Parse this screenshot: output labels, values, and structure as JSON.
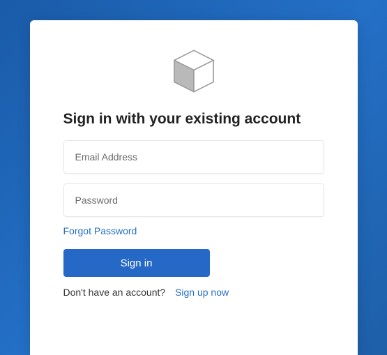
{
  "title": "Sign in with your existing account",
  "fields": {
    "email_placeholder": "Email Address",
    "password_placeholder": "Password"
  },
  "links": {
    "forgot": "Forgot Password",
    "signup": "Sign up now"
  },
  "buttons": {
    "signin": "Sign in"
  },
  "signup_prompt": "Don't have an account?",
  "colors": {
    "accent": "#2568c6",
    "bg_gradient_start": "#1a5ba8",
    "bg_gradient_end": "#2470c7"
  },
  "logo": {
    "name": "cube-icon"
  }
}
